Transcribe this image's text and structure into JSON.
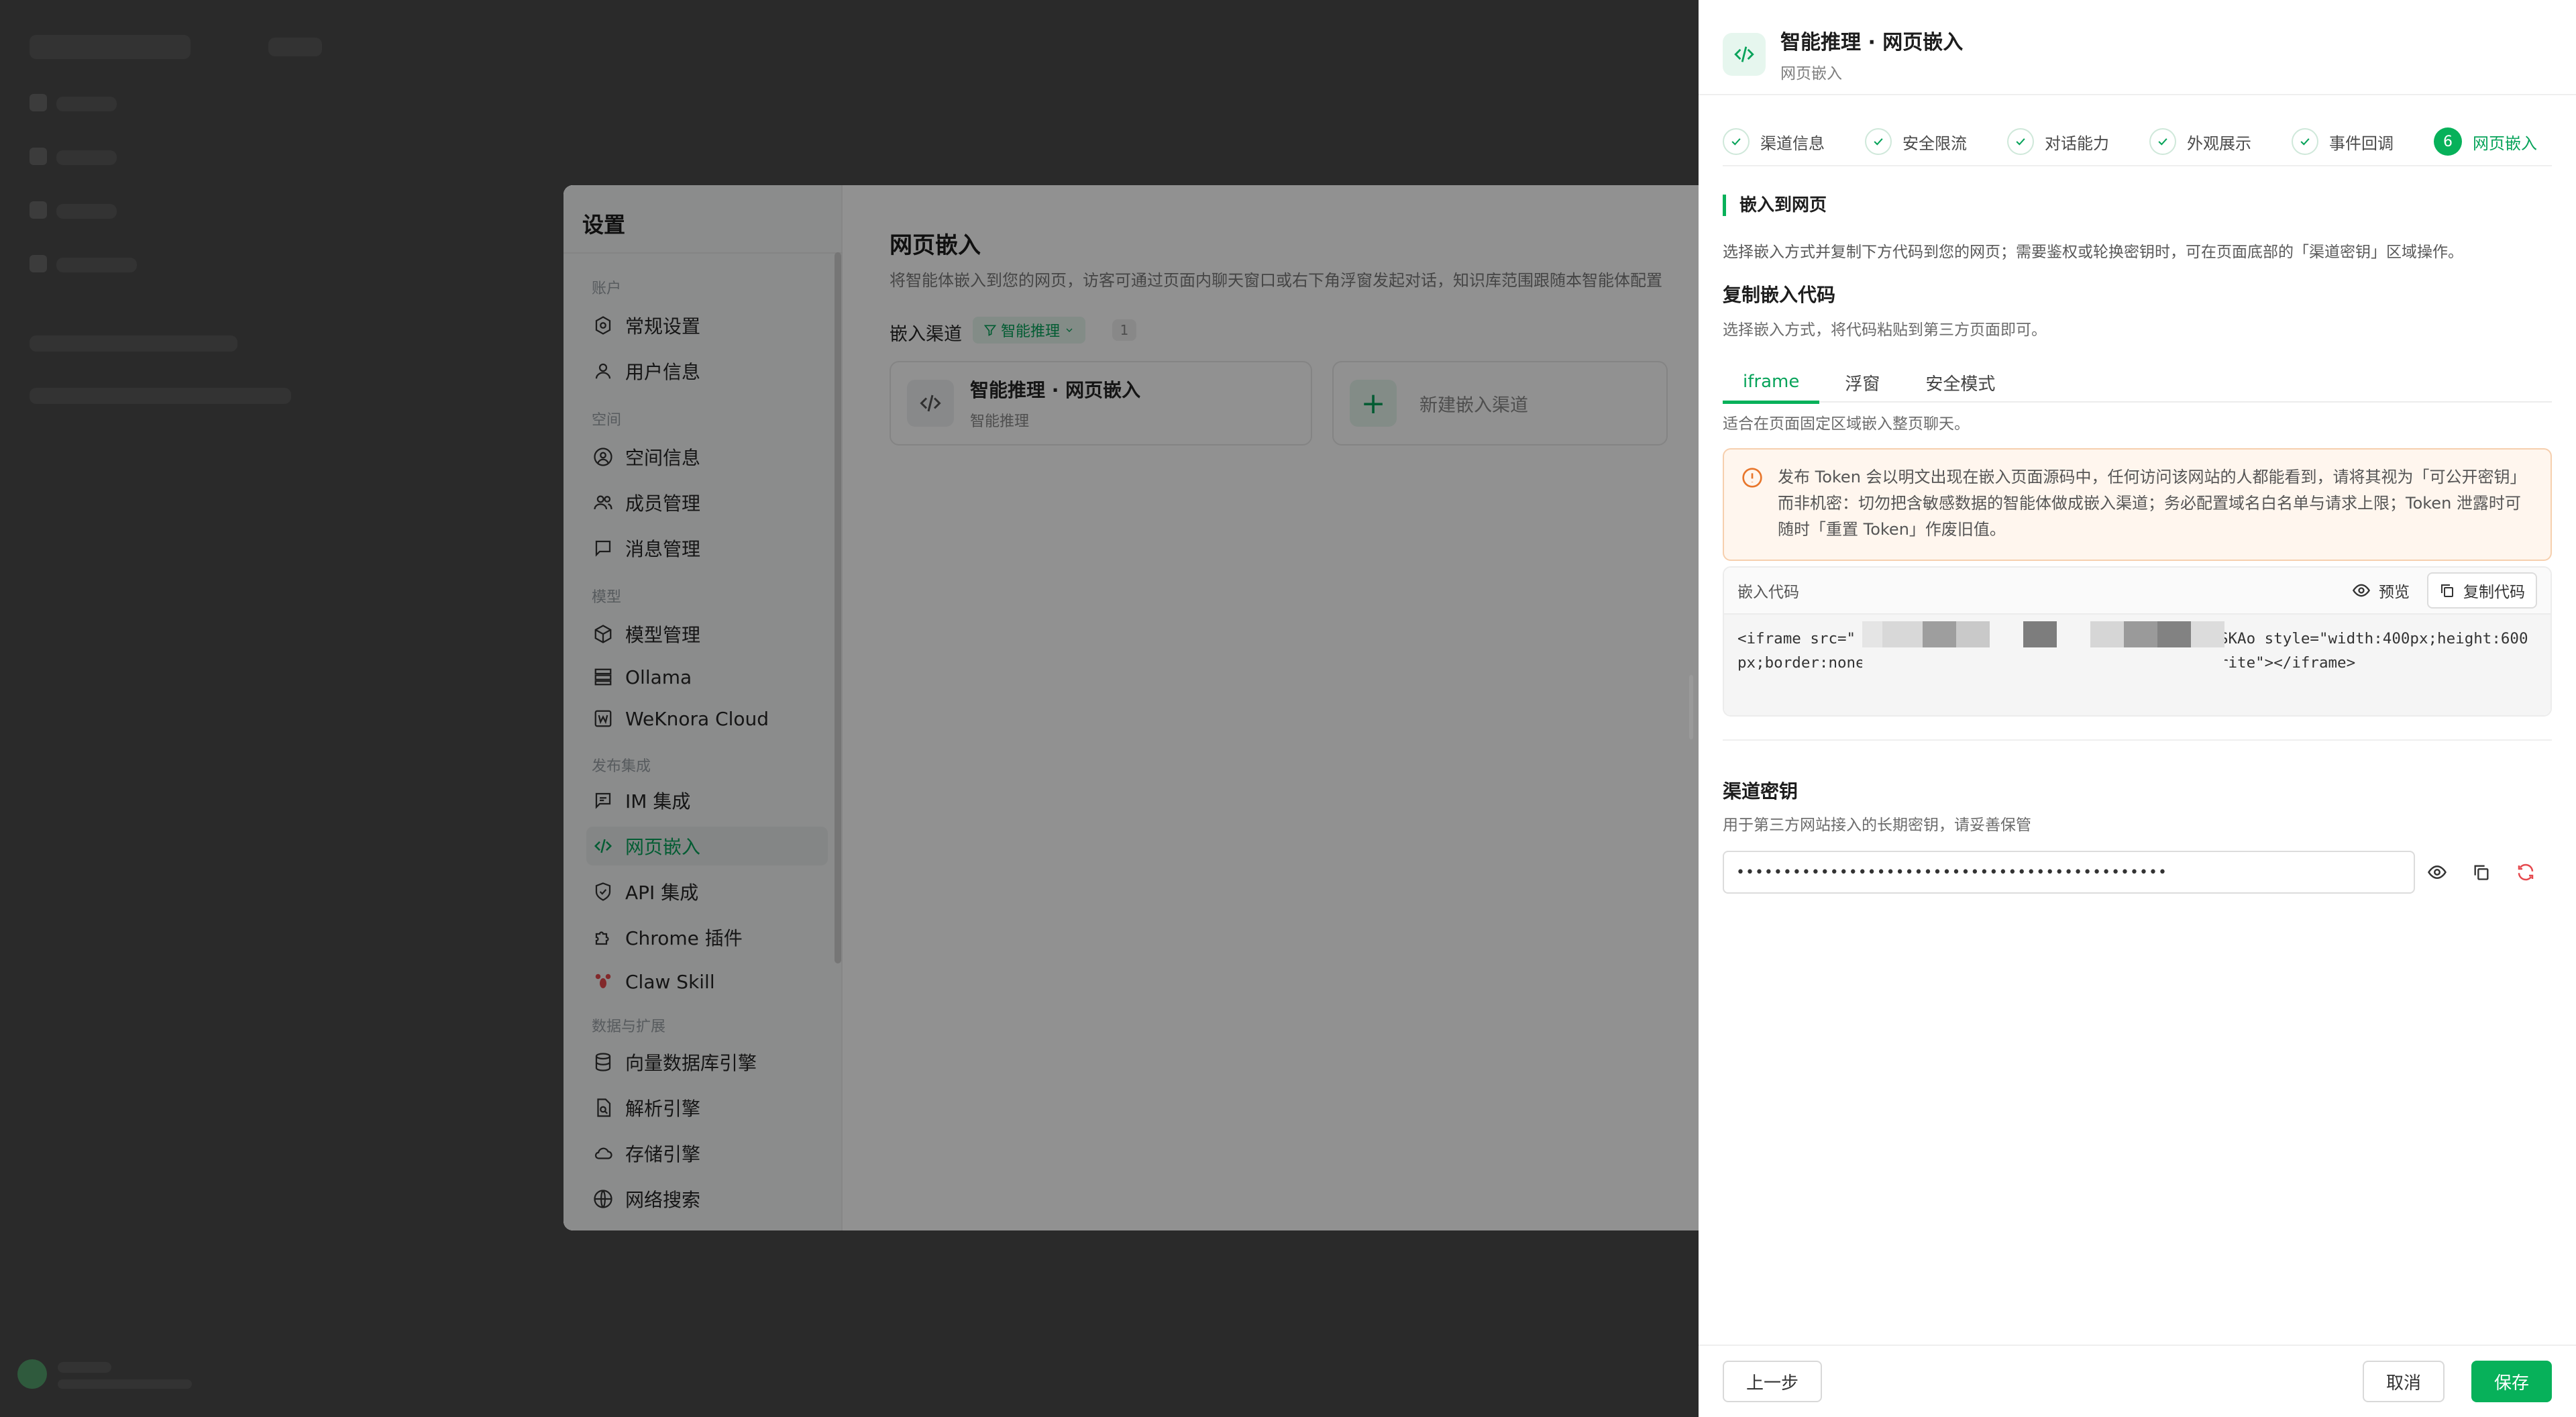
{
  "settings": {
    "title": "设置",
    "groups": {
      "account": "账户",
      "space": "空间",
      "model": "模型",
      "publish": "发布集成",
      "data": "数据与扩展"
    },
    "items": {
      "general": "常规设置",
      "user_info": "用户信息",
      "space_info": "空间信息",
      "members": "成员管理",
      "messages": "消息管理",
      "model_mgmt": "模型管理",
      "ollama": "Ollama",
      "weknora": "WeKnora Cloud",
      "im": "IM 集成",
      "web_embed": "网页嵌入",
      "api": "API 集成",
      "chrome": "Chrome 插件",
      "claw": "Claw Skill",
      "vector": "向量数据库引擎",
      "parser": "解析引擎",
      "storage": "存储引擎",
      "websearch": "网络搜索"
    },
    "main": {
      "title": "网页嵌入",
      "desc": "将智能体嵌入到您的网页，访客可通过页面内聊天窗口或右下角浮窗发起对话，知识库范围跟随本智能体配置",
      "channel_label": "嵌入渠道",
      "channel_pill": "智能推理",
      "channel_count": "1",
      "card_name": "智能推理 · 网页嵌入",
      "card_sub": "智能推理",
      "new_channel": "新建嵌入渠道"
    }
  },
  "drawer": {
    "title": "智能推理 · 网页嵌入",
    "subtitle": "网页嵌入",
    "steps": [
      "渠道信息",
      "安全限流",
      "对话能力",
      "外观展示",
      "事件回调",
      "网页嵌入"
    ],
    "current_step_number": "6",
    "section_title": "嵌入到网页",
    "section_desc": "选择嵌入方式并复制下方代码到您的网页；需要鉴权或轮换密钥时，可在页面底部的「渠道密钥」区域操作。",
    "copy_title": "复制嵌入代码",
    "copy_desc": "选择嵌入方式，将代码粘贴到第三方页面即可。",
    "tabs": [
      "iframe",
      "浮窗",
      "安全模式"
    ],
    "tab_desc": "适合在页面固定区域嵌入整页聊天。",
    "warning": "发布 Token 会以明文出现在嵌入页面源码中，任何访问该网站的人都能看到，请将其视为「可公开密钥」而非机密：切勿把含敏感数据的智能体做成嵌入渠道；务必配置域名白名单与请求上限；Token 泄露时可随时「重置 Token」作废旧值。",
    "code_label": "嵌入代码",
    "preview": "预览",
    "copy_code": "复制代码",
    "code": "<iframe src=\"                        a5f-42d1-a32d-aa0368e270fa#token=em_rzhSKAo                       style=\"width:400px;height:600px;border:none;border-radius:12px\" allow=\"clipboard-write\"></iframe>",
    "key_title": "渠道密钥",
    "key_desc": "用于第三方网站接入的长期密钥，请妥善保管",
    "key_value": "••••••••••••••••••••••••••••••••••••••••••••••",
    "buttons": {
      "prev": "上一步",
      "cancel": "取消",
      "save": "保存"
    }
  },
  "colors": {
    "accent": "#07b15a",
    "warning_border": "#f6cfae",
    "danger": "#e5484d"
  }
}
